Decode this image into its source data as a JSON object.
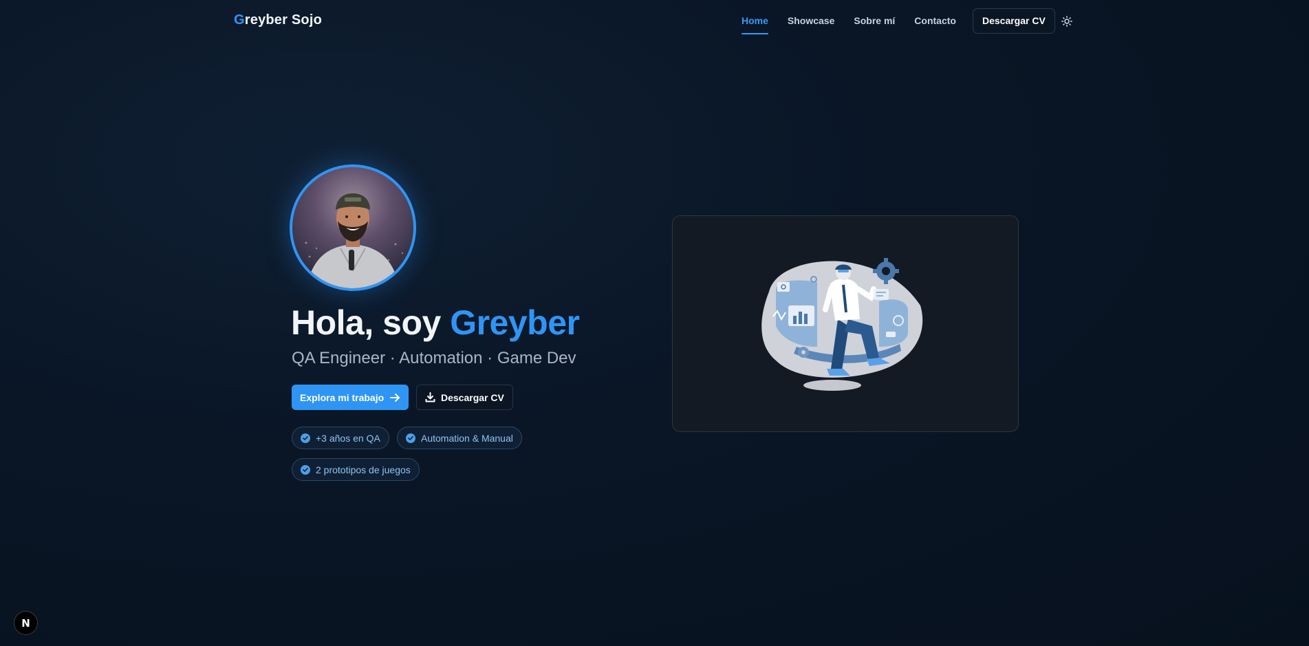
{
  "header": {
    "logo_first": "G",
    "logo_rest": "reyber Sojo",
    "nav": [
      {
        "label": "Home",
        "active": true
      },
      {
        "label": "Showcase",
        "active": false
      },
      {
        "label": "Sobre mí",
        "active": false
      },
      {
        "label": "Contacto",
        "active": false
      }
    ],
    "cv_button": "Descargar CV",
    "theme_icon": "sun-icon"
  },
  "hero": {
    "title_prefix": "Hola, soy ",
    "title_name": "Greyber",
    "subtitle": "QA Engineer · Automation · Game Dev",
    "primary_button": "Explora mi trabajo",
    "secondary_button": "Descargar CV",
    "badges": [
      "+3 años en QA",
      "Automation & Manual",
      "2 prototipos de juegos"
    ]
  },
  "colors": {
    "accent": "#2f95f5",
    "background": "#0a1626",
    "card": "#131a24"
  },
  "corner_badge": "N"
}
